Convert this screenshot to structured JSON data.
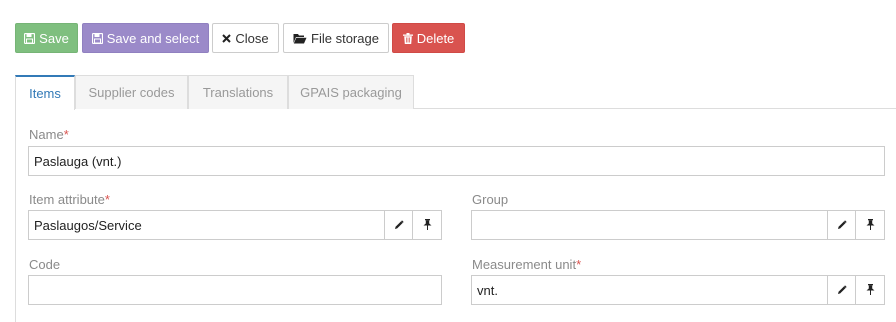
{
  "toolbar": {
    "save_label": "Save",
    "save_select_label": "Save and select",
    "close_label": "Close",
    "file_storage_label": "File storage",
    "delete_label": "Delete"
  },
  "tabs": [
    {
      "label": "Items",
      "active": true
    },
    {
      "label": "Supplier codes",
      "active": false
    },
    {
      "label": "Translations",
      "active": false
    },
    {
      "label": "GPAIS packaging",
      "active": false
    }
  ],
  "form": {
    "name": {
      "label": "Name",
      "required_mark": "*",
      "value": "Paslauga (vnt.)"
    },
    "item_attribute": {
      "label": "Item attribute",
      "required_mark": "*",
      "value": "Paslaugos/Service"
    },
    "group": {
      "label": "Group",
      "value": ""
    },
    "code": {
      "label": "Code",
      "value": ""
    },
    "measurement_unit": {
      "label": "Measurement unit",
      "required_mark": "*",
      "value": "vnt."
    }
  },
  "icons": {
    "save": "floppy-disk-icon",
    "close": "times-icon",
    "file_storage": "folder-open-icon",
    "delete": "trash-icon",
    "edit": "pencil-icon",
    "pin": "pushpin-icon"
  },
  "colors": {
    "save": "#7fbf7f",
    "save_select": "#9b8ac9",
    "delete": "#d9534f",
    "active_tab": "#337ab7",
    "required": "#d9534f"
  }
}
